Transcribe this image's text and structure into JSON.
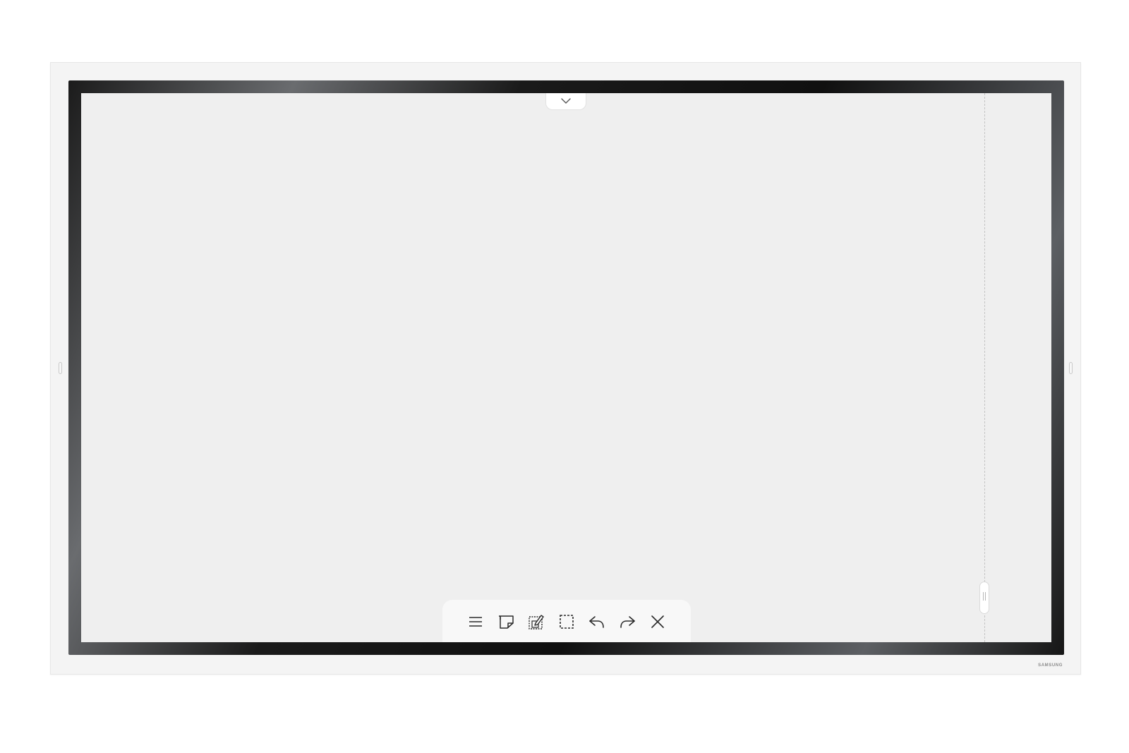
{
  "device": {
    "brand": "SAMSUNG",
    "bezel_color": "#141414",
    "frame_color": "#f4f4f4",
    "screen_color": "#efefef"
  },
  "top_tab": {
    "icon": "chevron-down-icon"
  },
  "toolbar": {
    "items": [
      {
        "name": "menu",
        "icon": "hamburger-menu-icon"
      },
      {
        "name": "sticky-note",
        "icon": "sticky-note-icon"
      },
      {
        "name": "capture-edit",
        "icon": "capture-edit-icon"
      },
      {
        "name": "select-area",
        "icon": "dashed-select-icon"
      },
      {
        "name": "undo",
        "icon": "undo-icon"
      },
      {
        "name": "redo",
        "icon": "redo-icon"
      },
      {
        "name": "close",
        "icon": "close-icon"
      }
    ]
  },
  "scroll_handle": {
    "icon": "grip-icon"
  }
}
